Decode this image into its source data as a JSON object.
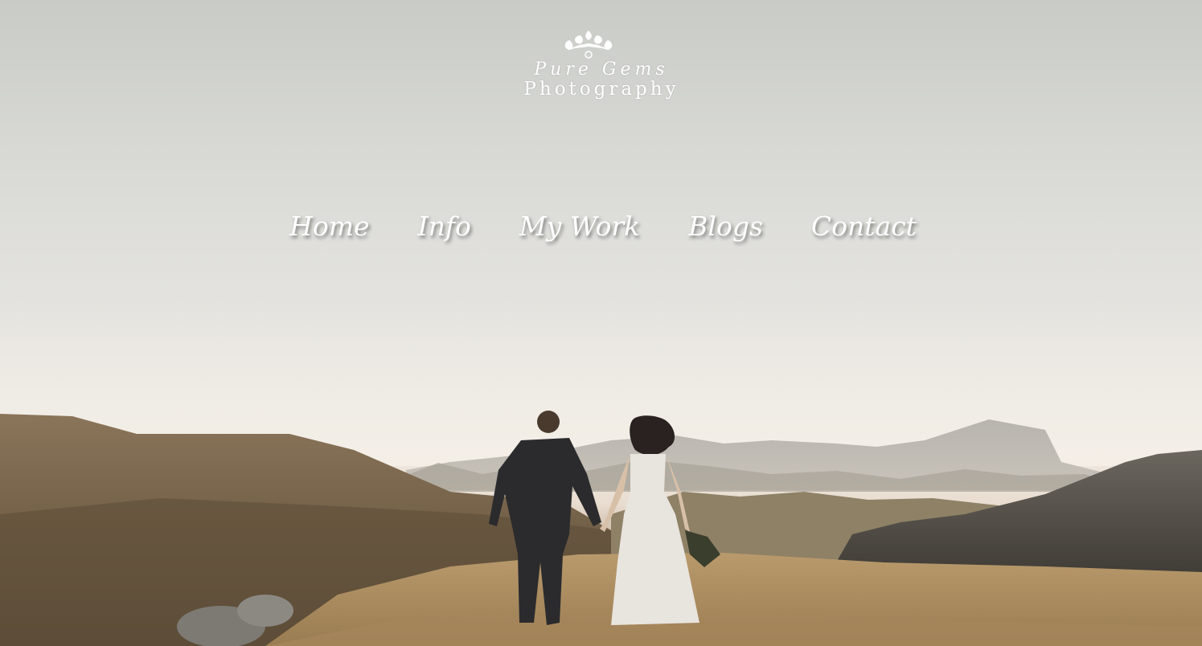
{
  "logo": {
    "tagline": "Pure Gems",
    "brand": "Photography",
    "crest_icon": "floral-crest-icon"
  },
  "nav": {
    "items": [
      {
        "label": "Home"
      },
      {
        "label": "Info"
      },
      {
        "label": "My Work"
      },
      {
        "label": "Blogs"
      },
      {
        "label": "Contact"
      }
    ]
  },
  "hero": {
    "image": "couple-walking-in-mountain-meadow-photo",
    "sky_color": "#d7d8d4",
    "ground_color": "#8b7556"
  }
}
